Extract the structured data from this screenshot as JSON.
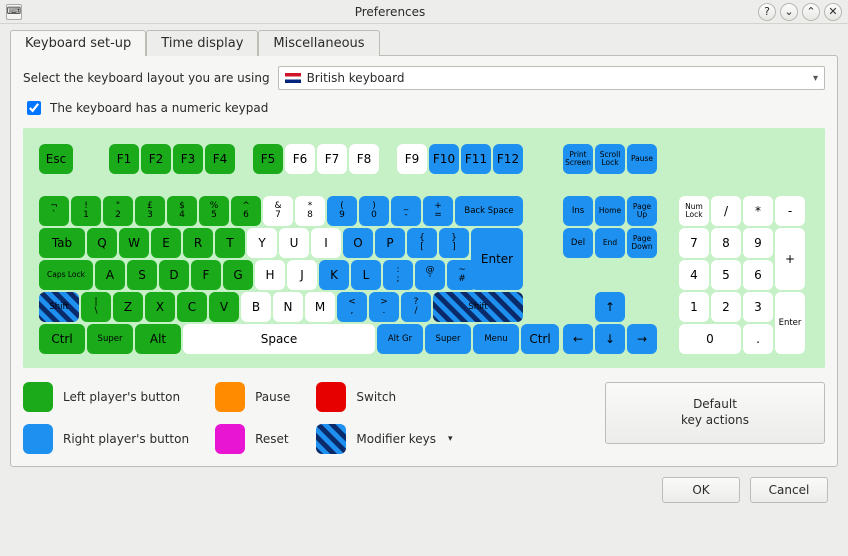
{
  "window": {
    "title": "Preferences"
  },
  "tabs": {
    "keyboard": "Keyboard set-up",
    "time": "Time display",
    "misc": "Miscellaneous"
  },
  "layout_label": "Select the keyboard layout you are using",
  "layout_value": "British keyboard",
  "numpad_label": "The keyboard has a numeric keypad",
  "legend": {
    "left": "Left player's button",
    "right": "Right player's button",
    "pause": "Pause",
    "reset": "Reset",
    "switch": "Switch",
    "mod": "Modifier keys"
  },
  "default_box_l1": "Default",
  "default_box_l2": "key actions",
  "footer": {
    "ok": "OK",
    "cancel": "Cancel"
  },
  "keys": {
    "esc": "Esc",
    "f1": "F1",
    "f2": "F2",
    "f3": "F3",
    "f4": "F4",
    "f5": "F5",
    "f6": "F6",
    "f7": "F7",
    "f8": "F8",
    "f9": "F9",
    "f10": "F10",
    "f11": "F11",
    "f12": "F12",
    "prtsc": "Print Screen",
    "scrlk": "Scroll Lock",
    "pause": "Pause",
    "backtick": "¬\n`",
    "n1": "!\n1",
    "n2": "\"\n2",
    "n3": "£\n3",
    "n4": "$\n4",
    "n5": "%\n5",
    "n6": "^\n6",
    "n7": "&\n7",
    "n8": "*\n8",
    "n9": "(\n9",
    "n0": ")\n0",
    "minus": "_\n-",
    "equals": "+\n=",
    "bksp": "Back Space",
    "tab": "Tab",
    "q": "Q",
    "w": "W",
    "e": "E",
    "r": "R",
    "t": "T",
    "y": "Y",
    "u": "U",
    "i": "I",
    "o": "O",
    "p": "P",
    "lbr": "{\n[",
    "rbr": "}\n]",
    "enter": "Enter",
    "caps": "Caps Lock",
    "a": "A",
    "s": "S",
    "d": "D",
    "f": "F",
    "g": "G",
    "h": "H",
    "j": "J",
    "k": "K",
    "l": "L",
    "semi": ":\n;",
    "apos": "@\n'",
    "hash": "~\n#",
    "lshift": "Shift",
    "bslash": "|\n\\",
    "z": "Z",
    "x": "X",
    "c": "C",
    "v": "V",
    "b": "B",
    "n": "N",
    "m": "M",
    "comma": "<\n,",
    "period": ">\n.",
    "slash": "?\n/",
    "rshift": "Shift",
    "lctrl": "Ctrl",
    "lsuper": "Super",
    "lalt": "Alt",
    "space": "Space",
    "altgr": "Alt Gr",
    "rsuper": "Super",
    "menu": "Menu",
    "rctrl": "Ctrl",
    "ins": "Ins",
    "home": "Home",
    "pgup": "Page Up",
    "del": "Del",
    "end": "End",
    "pgdn": "Page Down",
    "up": "↑",
    "left": "←",
    "down": "↓",
    "right": "→",
    "numlk": "Num Lock",
    "npdiv": "/",
    "npmul": "*",
    "npminus": "-",
    "np7": "7",
    "np8": "8",
    "np9": "9",
    "npplus": "+",
    "np4": "4",
    "np5": "5",
    "np6": "6",
    "np1": "1",
    "np2": "2",
    "np3": "3",
    "npenter": "Enter",
    "np0": "0",
    "npdot": "."
  }
}
